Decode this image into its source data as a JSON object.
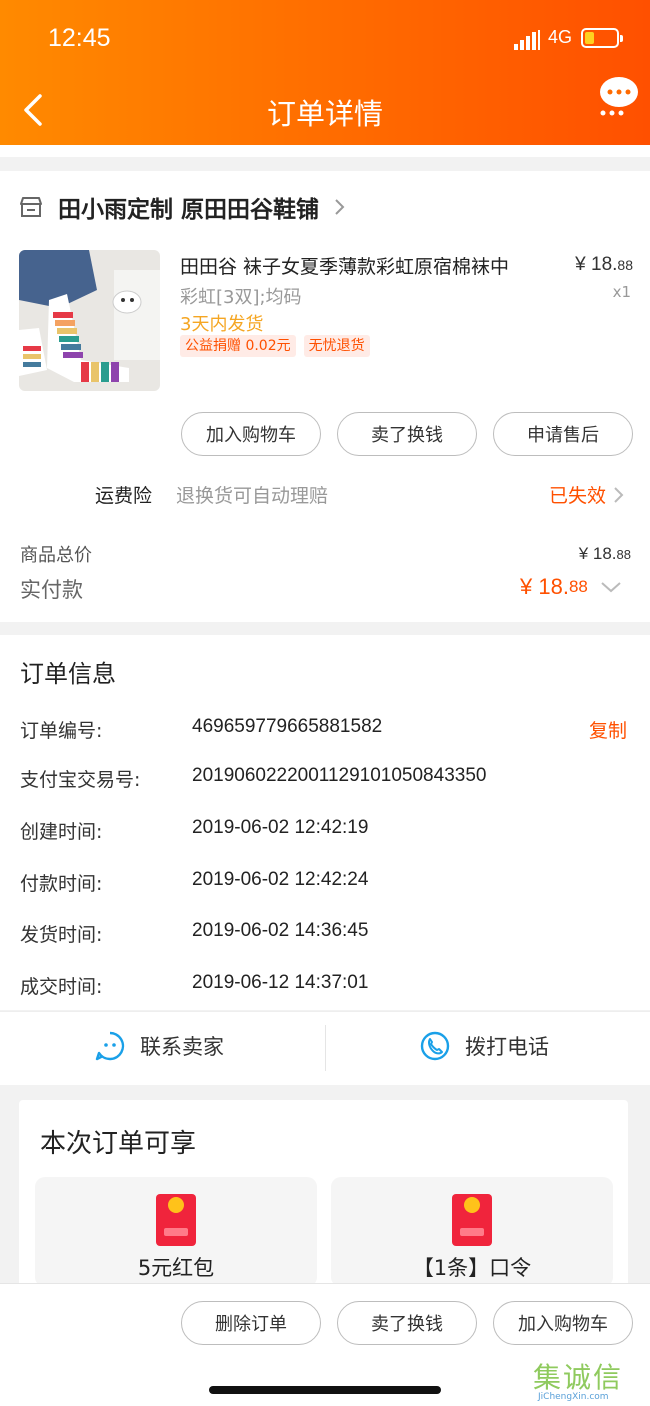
{
  "status_bar": {
    "time": "12:45",
    "network": "4G"
  },
  "header": {
    "title": "订单详情"
  },
  "shop": {
    "name": "田小雨定制 原田田谷鞋铺"
  },
  "product": {
    "title": "田田谷 袜子女夏季薄款彩虹原宿棉袜中",
    "sku": "彩虹[3双];均码",
    "ship": "3天内发货",
    "price_int": "¥ 18.",
    "price_dec": "88",
    "qty": "x1",
    "tags": [
      "公益捐赠 0.02元",
      "无忧退货"
    ],
    "buttons": [
      "加入购物车",
      "卖了换钱",
      "申请售后"
    ]
  },
  "insurance": {
    "label": "运费险",
    "desc": "退换货可自动理赔",
    "status": "已失效"
  },
  "totals": {
    "goods_label": "商品总价",
    "goods_int": "¥ 18.",
    "goods_dec": "88",
    "paid_label": "实付款",
    "paid_int": "¥ 18.",
    "paid_dec": "88"
  },
  "order_info": {
    "title": "订单信息",
    "copy": "复制",
    "rows": [
      {
        "label": "订单编号:",
        "value": "469659779665881582"
      },
      {
        "label": "支付宝交易号:",
        "value": "2019060222001129101050843350"
      },
      {
        "label": "创建时间:",
        "value": "2019-06-02 12:42:19"
      },
      {
        "label": "付款时间:",
        "value": "2019-06-02 12:42:24"
      },
      {
        "label": "发货时间:",
        "value": "2019-06-02 14:36:45"
      },
      {
        "label": "成交时间:",
        "value": "2019-06-12 14:37:01"
      }
    ]
  },
  "contact": {
    "seller": "联系卖家",
    "phone": "拨打电话"
  },
  "perks": {
    "title": "本次订单可享",
    "items": [
      "5元红包",
      "【1条】口令"
    ]
  },
  "bottom_bar": {
    "buttons": [
      "删除订单",
      "卖了换钱",
      "加入购物车"
    ]
  },
  "watermark": {
    "text": "集诚信",
    "url": "JiChengXin.com"
  }
}
